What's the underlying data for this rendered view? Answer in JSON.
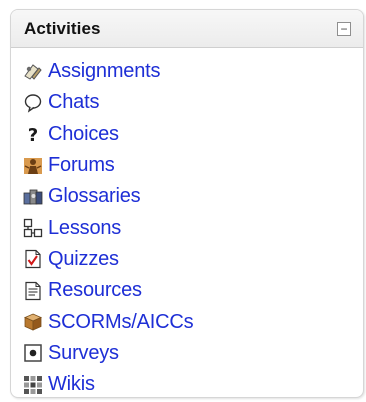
{
  "block": {
    "title": "Activities",
    "collapse_glyph": "−",
    "link_color": "#1e2fd6"
  },
  "items": [
    {
      "label": "Assignments",
      "icon": "assignment-icon"
    },
    {
      "label": "Chats",
      "icon": "chat-icon"
    },
    {
      "label": "Choices",
      "icon": "choice-icon"
    },
    {
      "label": "Forums",
      "icon": "forum-icon"
    },
    {
      "label": "Glossaries",
      "icon": "glossary-icon"
    },
    {
      "label": "Lessons",
      "icon": "lesson-icon"
    },
    {
      "label": "Quizzes",
      "icon": "quiz-icon"
    },
    {
      "label": "Resources",
      "icon": "resource-icon"
    },
    {
      "label": "SCORMs/AICCs",
      "icon": "scorm-icon"
    },
    {
      "label": "Surveys",
      "icon": "survey-icon"
    },
    {
      "label": "Wikis",
      "icon": "wiki-icon"
    }
  ]
}
